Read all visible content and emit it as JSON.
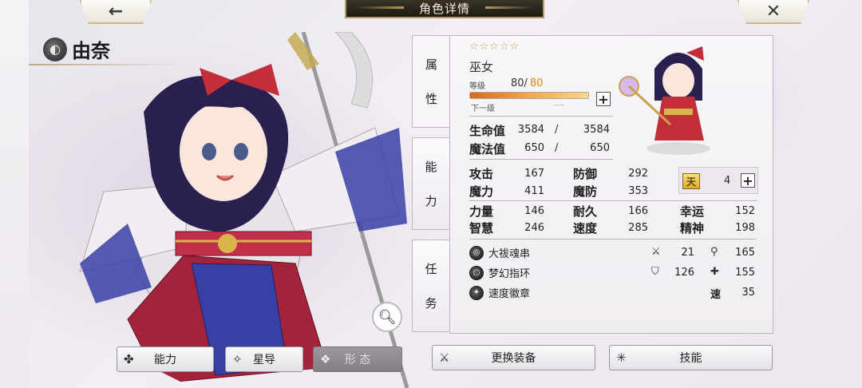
{
  "header": {
    "title": "角色详情",
    "back_icon": "←",
    "close_icon": "✕"
  },
  "character": {
    "name": "由奈",
    "stars": "☆☆☆☆☆",
    "job": "巫女",
    "level_label": "等级",
    "level_current": "80/",
    "level_max": "80",
    "level_progress": 1.0,
    "next_label": "下一级",
    "next_value": "----"
  },
  "tabs": {
    "attr": [
      "属",
      "性"
    ],
    "ability": [
      "能",
      "力"
    ],
    "task": [
      "任",
      "务"
    ]
  },
  "vitals": {
    "hp_label": "生命值",
    "hp_cur": "3584",
    "hp_max": "3584",
    "mp_label": "魔法值",
    "mp_cur": "650",
    "mp_max": "650",
    "slash": "/"
  },
  "stats": {
    "atk_label": "攻击",
    "atk": "167",
    "def_label": "防御",
    "def": "292",
    "mag_label": "魔力",
    "mag": "411",
    "mdef_label": "魔防",
    "mdef": "353",
    "str_label": "力量",
    "str": "146",
    "end_label": "耐久",
    "end": "166",
    "luck_label": "幸运",
    "luck": "152",
    "int_label": "智慧",
    "int": "246",
    "spd_label": "速度",
    "spd": "285",
    "spi_label": "精神",
    "spi": "198"
  },
  "rank": {
    "icon_text": "天",
    "value": "4"
  },
  "equipment": [
    {
      "name": "大祓魂串",
      "stat1": "21",
      "stat2": "165"
    },
    {
      "name": "梦幻指环",
      "stat1": "126",
      "stat2": "155"
    },
    {
      "name": "速度徽章",
      "speed_label": "速",
      "stat2": "35"
    }
  ],
  "buttons": {
    "ability": "能力",
    "starguide": "星导",
    "form": "形 态",
    "change_equip": "更换装备",
    "skill": "技能"
  },
  "colors": {
    "accent_gold": "#c9a34a",
    "level_max_orange": "#d38a1a",
    "title_bar": "#2a251c"
  }
}
